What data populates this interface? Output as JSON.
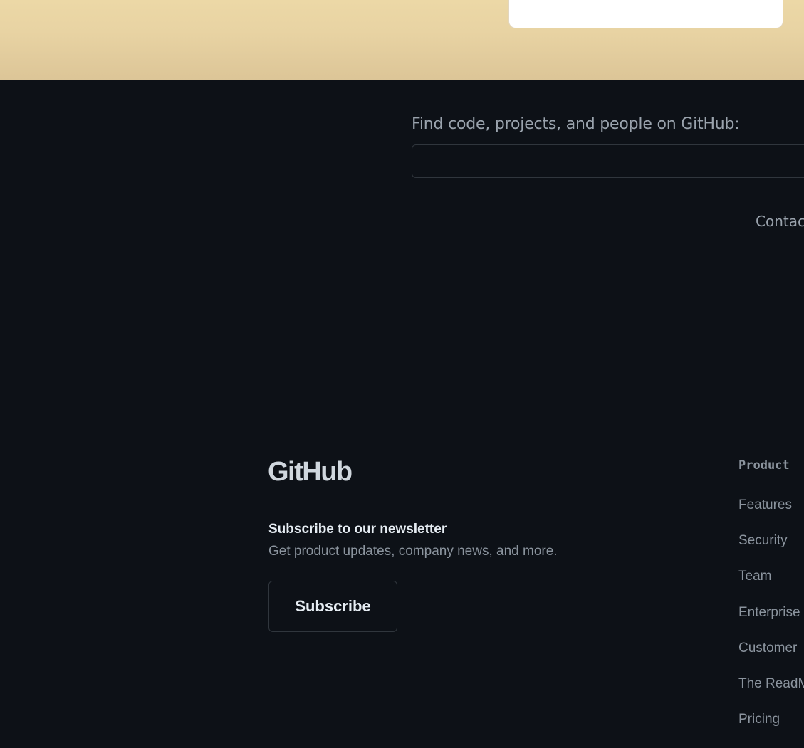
{
  "search": {
    "label": "Find code, projects, and people on GitHub:",
    "value": "",
    "placeholder": ""
  },
  "contact": {
    "label": "Contac"
  },
  "footer": {
    "logo_text": "GitHub",
    "newsletter": {
      "title": "Subscribe to our newsletter",
      "description": "Get product updates, company news, and more.",
      "button_label": "Subscribe"
    },
    "product": {
      "heading": "Product",
      "links": [
        {
          "label": "Features"
        },
        {
          "label": "Security"
        },
        {
          "label": "Team"
        },
        {
          "label": "Enterprise"
        },
        {
          "label": "Customer"
        },
        {
          "label": "The ReadM"
        },
        {
          "label": "Pricing"
        }
      ]
    }
  },
  "colors": {
    "background": "#0d1117",
    "top_band": "#e8d3a3",
    "text_muted": "#8b949e",
    "border": "#30363d"
  }
}
